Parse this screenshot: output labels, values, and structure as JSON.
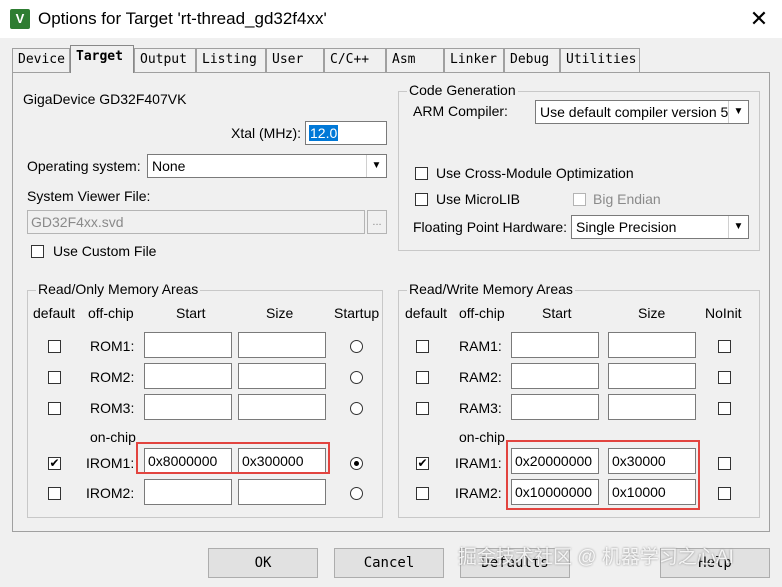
{
  "window": {
    "title": "Options for Target 'rt-thread_gd32f4xx'",
    "close_glyph": "✕",
    "icon_glyph": "V"
  },
  "tabs": [
    "Device",
    "Target",
    "Output",
    "Listing",
    "User",
    "C/C++",
    "Asm",
    "Linker",
    "Debug",
    "Utilities"
  ],
  "active_tab": "Target",
  "device": {
    "name": "GigaDevice GD32F407VK",
    "xtal_label": "Xtal (MHz):",
    "xtal_value": "12.0",
    "os_label": "Operating system:",
    "os_value": "None",
    "svd_label": "System Viewer File:",
    "svd_value": "GD32F4xx.svd",
    "browse_label": "...",
    "custom_file_label": "Use Custom File",
    "custom_file_checked": false
  },
  "codegen": {
    "title": "Code Generation",
    "compiler_label": "ARM Compiler:",
    "compiler_value": "Use default compiler version 5",
    "cross_module_label": "Use Cross-Module Optimization",
    "microlib_label": "Use MicroLIB",
    "big_endian_label": "Big Endian",
    "fpu_label": "Floating Point Hardware:",
    "fpu_value": "Single Precision"
  },
  "rom": {
    "title": "Read/Only Memory Areas",
    "headers": {
      "default": "default",
      "offchip": "off-chip",
      "start": "Start",
      "size": "Size",
      "startup": "Startup"
    },
    "onchip_label": "on-chip",
    "rows": [
      {
        "name": "ROM1:",
        "start": "",
        "size": "",
        "default": false,
        "startup": false
      },
      {
        "name": "ROM2:",
        "start": "",
        "size": "",
        "default": false,
        "startup": false
      },
      {
        "name": "ROM3:",
        "start": "",
        "size": "",
        "default": false,
        "startup": false
      },
      {
        "name": "IROM1:",
        "start": "0x8000000",
        "size": "0x300000",
        "default": true,
        "startup": true
      },
      {
        "name": "IROM2:",
        "start": "",
        "size": "",
        "default": false,
        "startup": false
      }
    ]
  },
  "ram": {
    "title": "Read/Write Memory Areas",
    "headers": {
      "default": "default",
      "offchip": "off-chip",
      "start": "Start",
      "size": "Size",
      "noinit": "NoInit"
    },
    "onchip_label": "on-chip",
    "rows": [
      {
        "name": "RAM1:",
        "start": "",
        "size": "",
        "default": false,
        "noinit": false
      },
      {
        "name": "RAM2:",
        "start": "",
        "size": "",
        "default": false,
        "noinit": false
      },
      {
        "name": "RAM3:",
        "start": "",
        "size": "",
        "default": false,
        "noinit": false
      },
      {
        "name": "IRAM1:",
        "start": "0x20000000",
        "size": "0x30000",
        "default": true,
        "noinit": false
      },
      {
        "name": "IRAM2:",
        "start": "0x10000000",
        "size": "0x10000",
        "default": false,
        "noinit": false
      }
    ]
  },
  "footer": {
    "ok": "OK",
    "cancel": "Cancel",
    "defaults": "Defaults",
    "help": "Help"
  },
  "watermark": "掘金技术社区 @ 机器学习之心AI",
  "colors": {
    "highlight_box": "#e2443f",
    "selection": "#0078d7"
  }
}
